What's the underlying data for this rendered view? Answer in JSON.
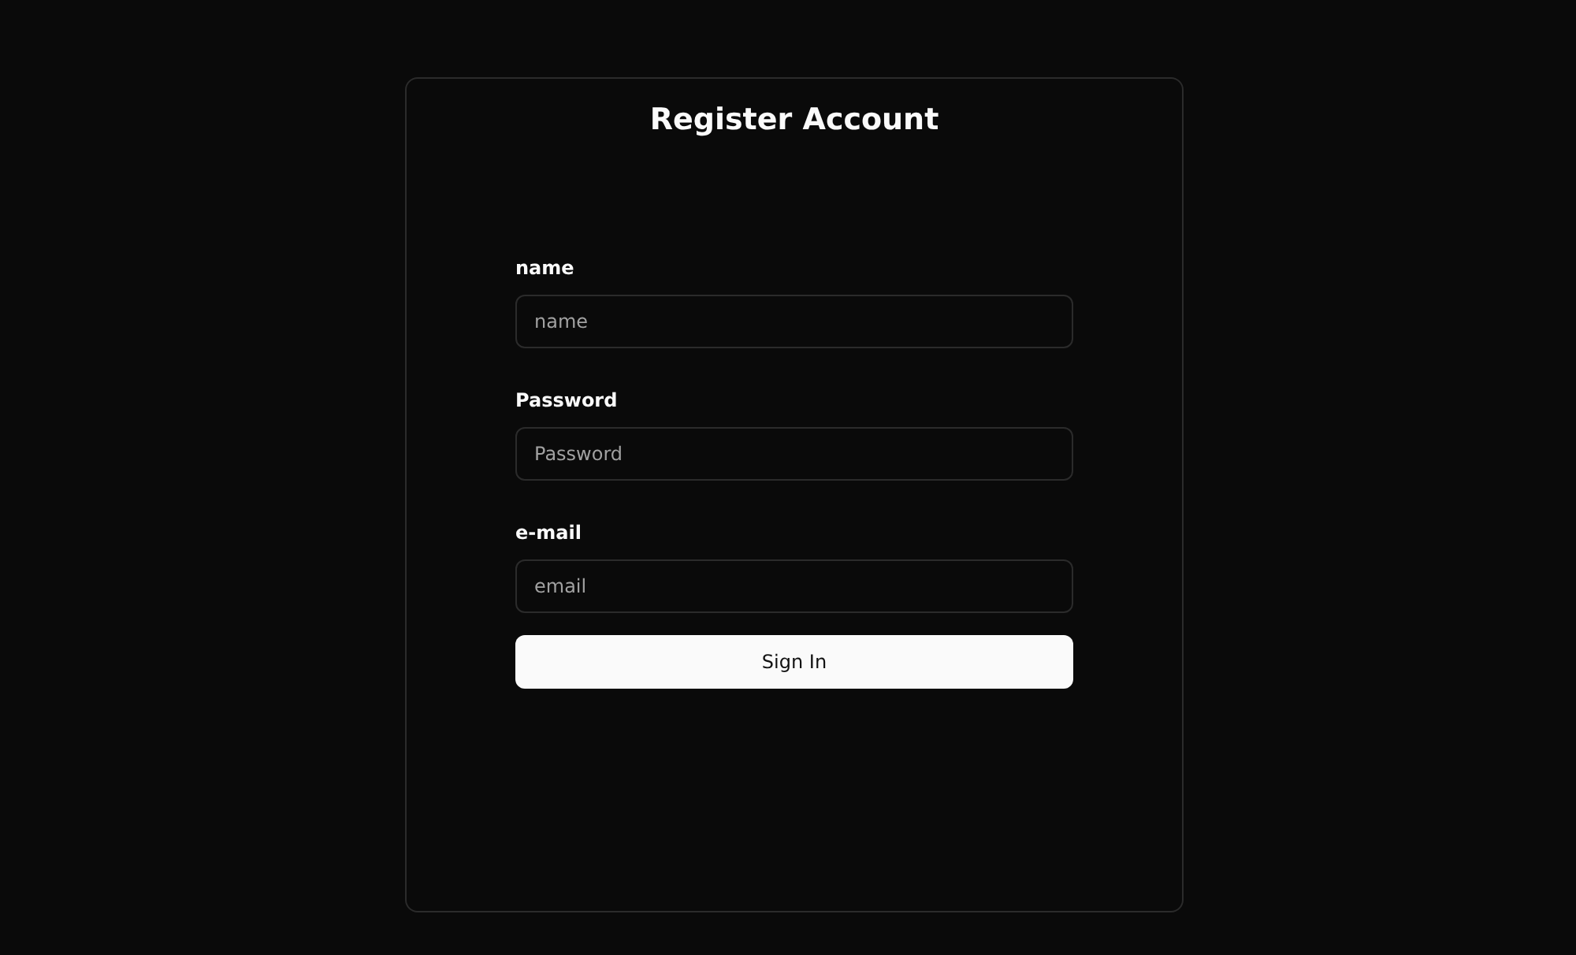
{
  "title": "Register Account",
  "fields": [
    {
      "label": "name",
      "placeholder": "name"
    },
    {
      "label": "Password",
      "placeholder": "Password"
    },
    {
      "label": "e-mail",
      "placeholder": "email"
    }
  ],
  "button": "Sign In"
}
